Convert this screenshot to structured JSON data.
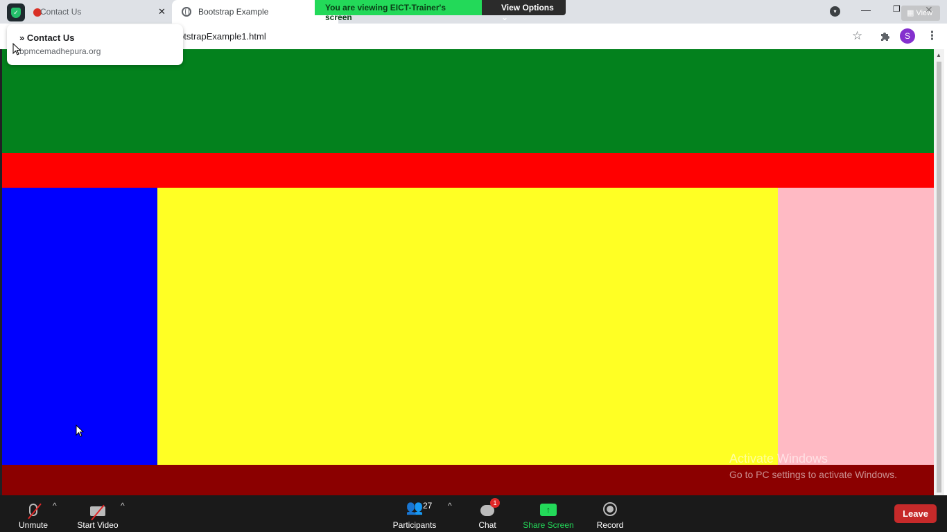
{
  "browser": {
    "tabs": [
      {
        "label": "Contact Us"
      },
      {
        "label": "Bootstrap Example"
      }
    ],
    "tab_close_glyph": "✕",
    "url_partial": "otstrapExample1.html",
    "profile_initial": "S",
    "tooltip": {
      "title": "» Contact Us",
      "domain": "bpmcemadhepura.org"
    }
  },
  "zoom_banner": {
    "message": "You are viewing EICT-Trainer's screen",
    "options": "View Options ⌄",
    "view_button": "View"
  },
  "page_blocks": {
    "header_color": "#03811d",
    "nav_color": "#ff0000",
    "left_color": "#0000ff",
    "center_color": "#ffff24",
    "right_color": "#ffbac4",
    "footer_color": "#8b0000"
  },
  "watermark": {
    "line1": "Activate Windows",
    "line2": "Go to PC settings to activate Windows."
  },
  "zoom_controls": {
    "unmute": "Unmute",
    "start_video": "Start Video",
    "participants": "Participants",
    "participant_count": "27",
    "chat": "Chat",
    "chat_badge": "1",
    "share_screen": "Share Screen",
    "record": "Record",
    "leave": "Leave",
    "caret": "^",
    "share_arrow": "↑"
  },
  "icons": {
    "shield": "shield-icon",
    "globe": "globe-icon",
    "star": "star-icon",
    "puzzle": "puzzle-icon",
    "kebab": "kebab-menu-icon"
  }
}
